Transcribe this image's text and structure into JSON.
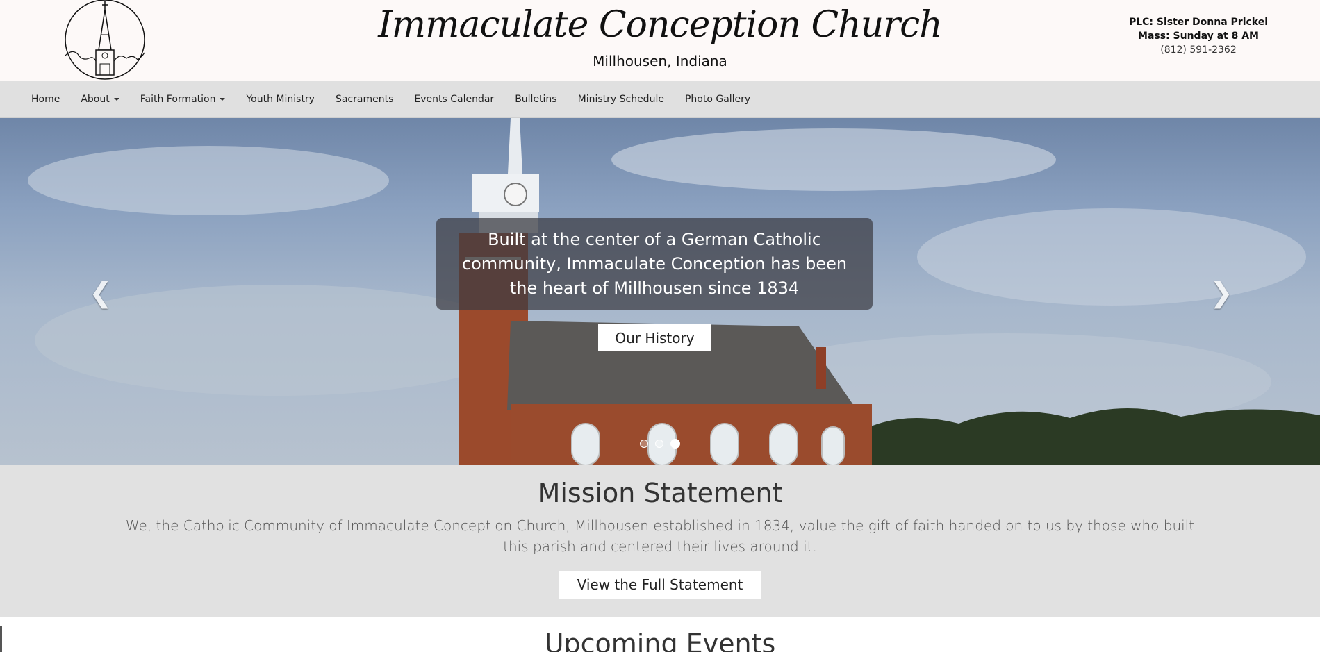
{
  "header": {
    "title": "Immaculate Conception Church",
    "subtitle": "Millhousen, Indiana",
    "contact": {
      "line1": "PLC: Sister Donna Prickel",
      "line2": "Mass: Sunday at 8 AM",
      "line3": "(812) 591-2362"
    }
  },
  "nav": {
    "items": [
      {
        "label": "Home",
        "dropdown": false
      },
      {
        "label": "About",
        "dropdown": true
      },
      {
        "label": "Faith Formation",
        "dropdown": true
      },
      {
        "label": "Youth Ministry",
        "dropdown": false
      },
      {
        "label": "Sacraments",
        "dropdown": false
      },
      {
        "label": "Events Calendar",
        "dropdown": false
      },
      {
        "label": "Bulletins",
        "dropdown": false
      },
      {
        "label": "Ministry Schedule",
        "dropdown": false
      },
      {
        "label": "Photo Gallery",
        "dropdown": false
      }
    ]
  },
  "hero": {
    "caption": "Built at the center of a German Catholic community, Immaculate Conception has been the heart of Millhousen since 1834",
    "button_label": "Our History",
    "prev_icon": "chevron-left-icon",
    "next_icon": "chevron-right-icon",
    "slide_count": 3,
    "active_slide": 3
  },
  "mission": {
    "heading": "Mission Statement",
    "text": "We, the Catholic Community of Immaculate Conception Church, Millhousen established in 1834, value the gift of faith handed on to us by those who built this parish and centered their lives around it.",
    "button_label": "View the Full Statement"
  },
  "events": {
    "heading": "Upcoming Events"
  },
  "colors": {
    "header_bg": "#fdf9f8",
    "nav_bg": "#e0e0e0",
    "mission_bg": "#e1e1e1",
    "caption_bg": "#3c3c42"
  }
}
